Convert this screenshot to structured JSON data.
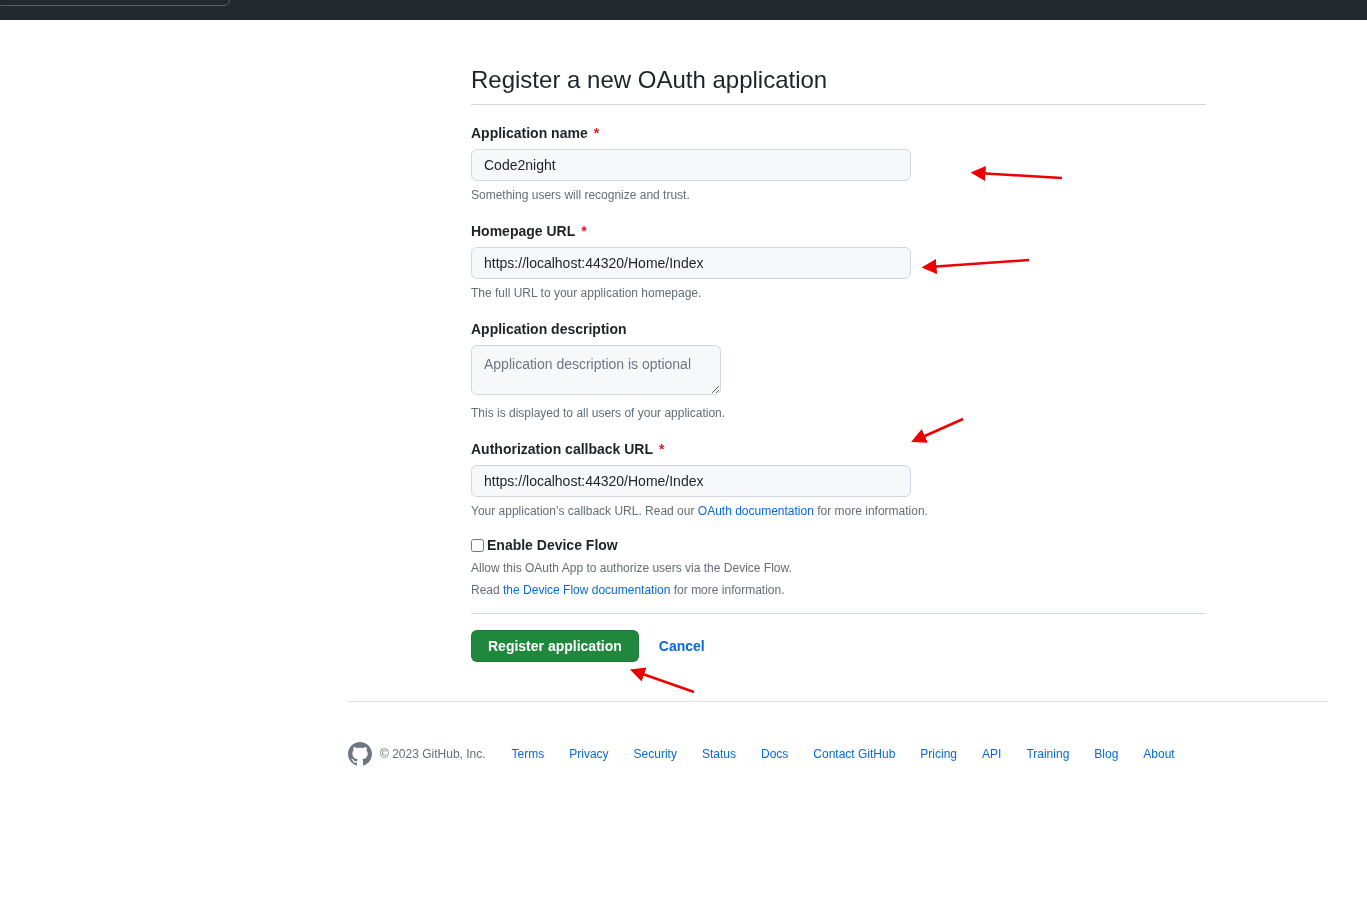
{
  "title": "Register a new OAuth application",
  "fields": [
    {
      "kind": "input",
      "label": "Application name",
      "required": true,
      "value": "Code2night",
      "hint": {
        "before": "Something users will recognize and trust."
      }
    },
    {
      "kind": "input",
      "label": "Homepage URL",
      "required": true,
      "value": "https://localhost:44320/Home/Index",
      "hint": {
        "before": "The full URL to your application homepage."
      }
    },
    {
      "kind": "textarea",
      "label": "Application description",
      "required": false,
      "placeholder": "Application description is optional",
      "hint": {
        "before": "This is displayed to all users of your application."
      }
    },
    {
      "kind": "input",
      "label": "Authorization callback URL",
      "required": true,
      "value": "https://localhost:44320/Home/Index",
      "hint": {
        "before": "Your application’s callback URL. Read our",
        "link": "OAuth documentation",
        "after": "for more information."
      }
    }
  ],
  "required_mark": "*",
  "device_flow": {
    "label": "Enable Device Flow",
    "checked": false,
    "notes": [
      {
        "before": "Allow this OAuth App to authorize users via the Device Flow."
      },
      {
        "before": "Read",
        "link": "the Device Flow documentation",
        "after": "for more information."
      }
    ]
  },
  "actions": {
    "submit": "Register application",
    "cancel": "Cancel"
  },
  "footer": {
    "copyright": "© 2023 GitHub, Inc.",
    "links": [
      "Terms",
      "Privacy",
      "Security",
      "Status",
      "Docs",
      "Contact GitHub",
      "Pricing",
      "API",
      "Training",
      "Blog",
      "About"
    ]
  }
}
